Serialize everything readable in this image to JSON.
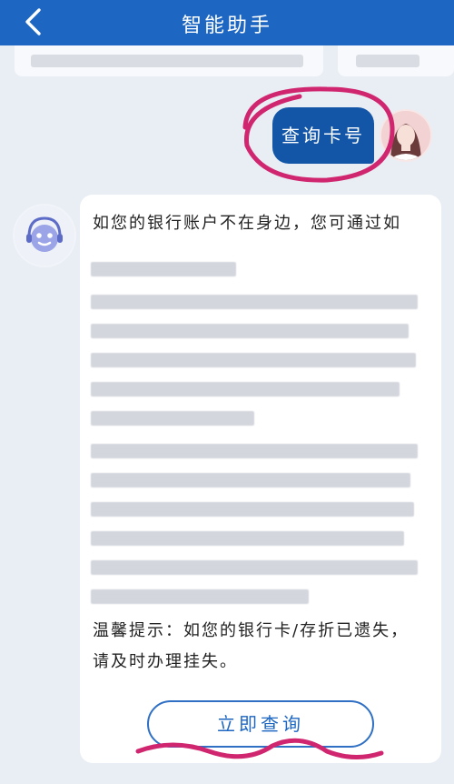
{
  "header": {
    "title": "智能助手"
  },
  "user_message": {
    "text": "查询卡号"
  },
  "bot_message": {
    "intro": "如您的银行账户不在身边，您可通过如",
    "tip_line1": "温馨提示：如您的银行卡/存折已遗失，",
    "tip_line2": "请及时办理挂失。",
    "button_label": "立即查询"
  },
  "colors": {
    "accent": "#1d66c2",
    "user_bubble": "#1356a8",
    "annotation": "#d0266f"
  },
  "icons": {
    "back": "chevron-left-icon",
    "bot_avatar": "robot-avatar-icon",
    "user_avatar": "user-avatar-icon"
  }
}
